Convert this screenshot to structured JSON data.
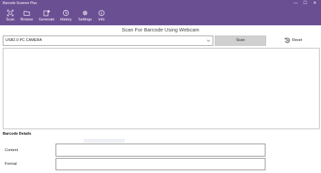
{
  "window": {
    "title": "Barcode Scanner Plus",
    "controls": [
      "—",
      "☐",
      "✕"
    ]
  },
  "toolbar": {
    "items": [
      {
        "label": "Scan",
        "icon": "scan-icon"
      },
      {
        "label": "Browse",
        "icon": "folder-icon"
      },
      {
        "label": "Generate",
        "icon": "generate-icon"
      },
      {
        "label": "History",
        "icon": "history-icon"
      },
      {
        "label": "Settings",
        "icon": "gear-icon"
      },
      {
        "label": "Info",
        "icon": "info-icon"
      }
    ]
  },
  "colors": {
    "accent": "#6b4f93",
    "button": "#d0d0d0"
  },
  "main": {
    "heading": "Scan For Barcode Using Webcam",
    "camera_select": {
      "value": "USB2.0 PC CAMERA"
    },
    "scan_label": "Scan",
    "reset_label": "Reset"
  },
  "details": {
    "section_title": "Barcode Details",
    "content_label": "Content",
    "content_value": "",
    "format_label": "Format",
    "format_value": ""
  }
}
